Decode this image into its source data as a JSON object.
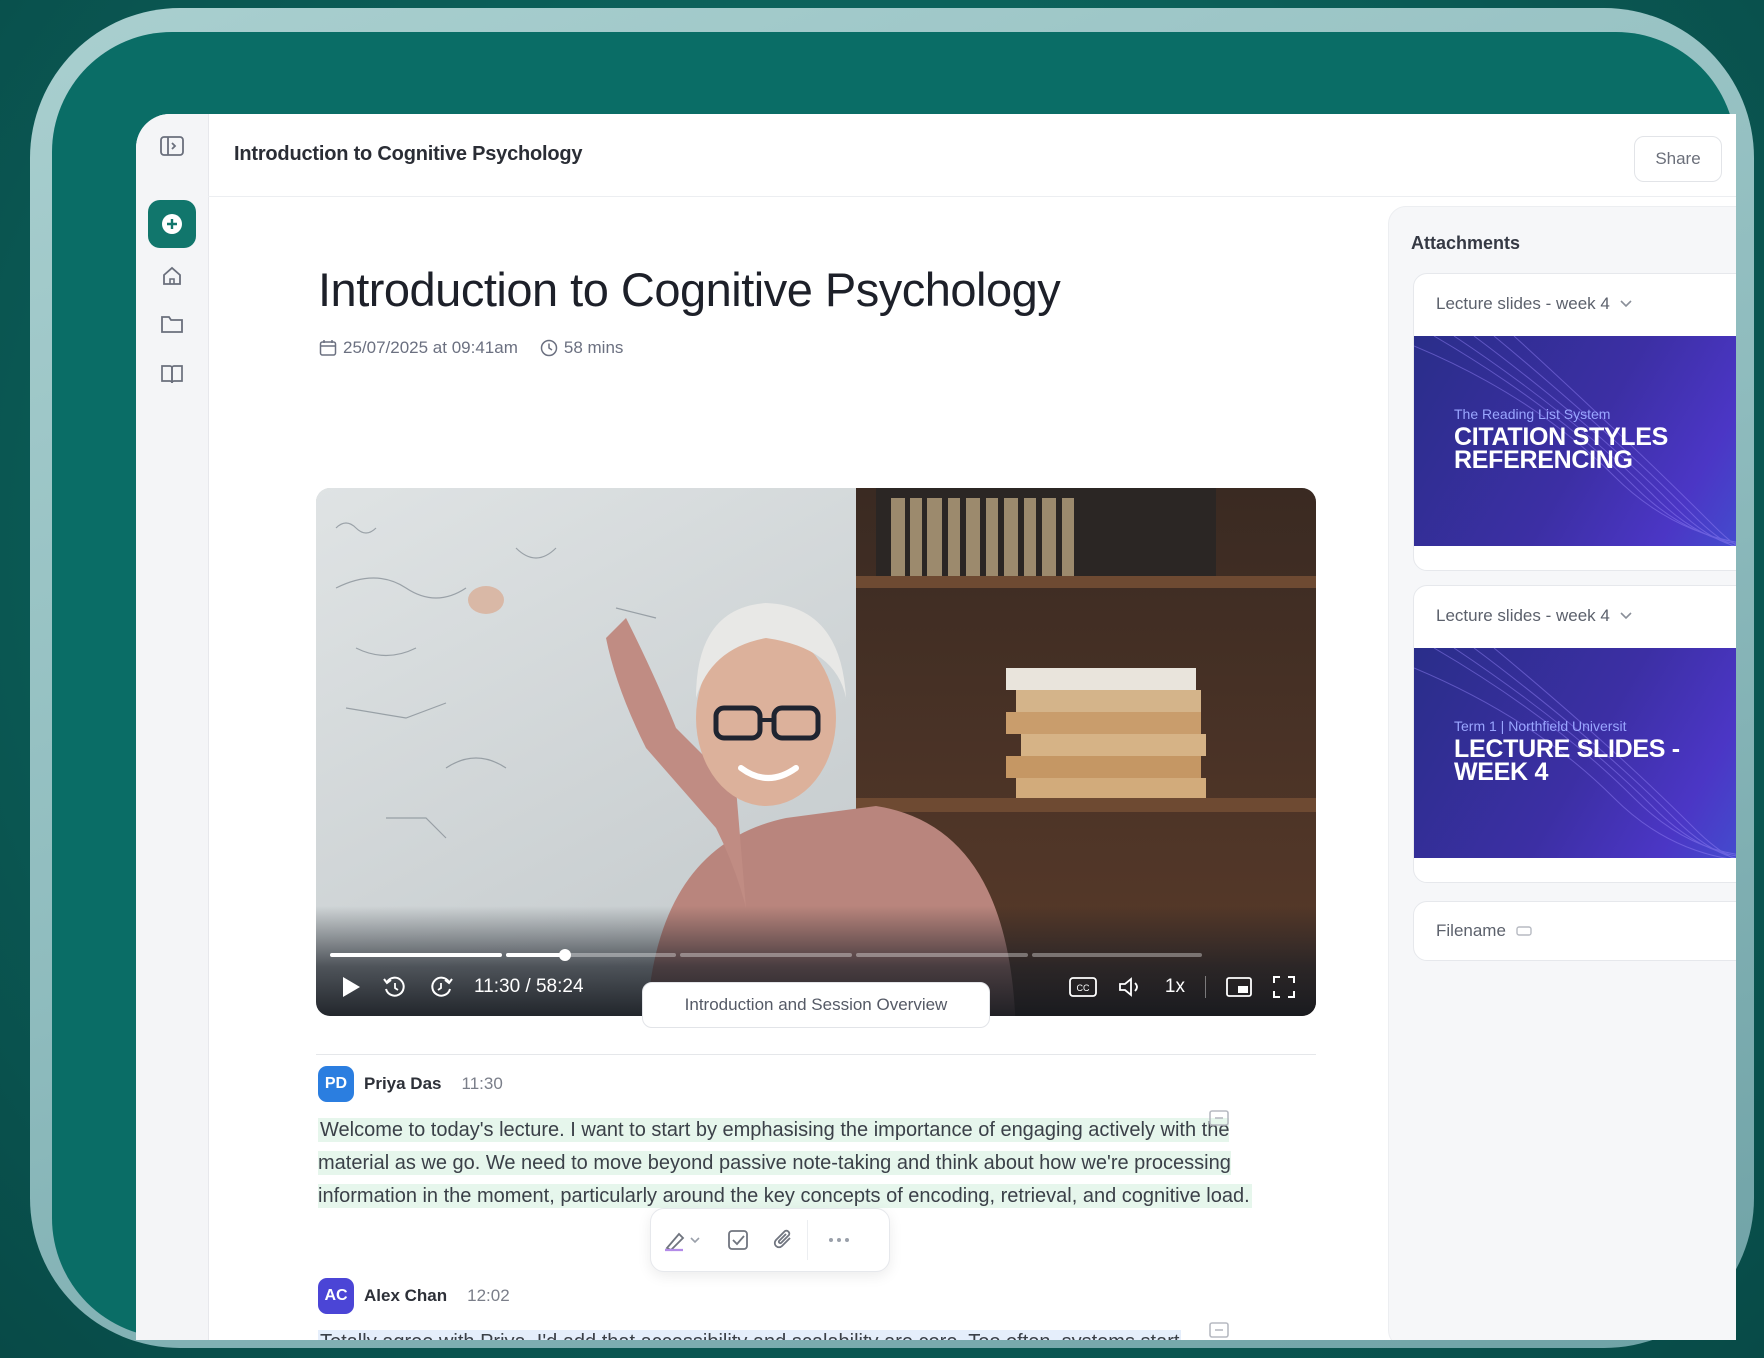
{
  "app": {
    "title": "Introduction to Cognitive Psychology",
    "share_label": "Share"
  },
  "rail": {
    "icons": [
      "sidebar-toggle-icon",
      "plus-icon",
      "home-icon",
      "folder-icon",
      "book-icon"
    ]
  },
  "lecture": {
    "heading": "Introduction to Cognitive Psychology",
    "date": "25/07/2025 at 09:41am",
    "duration": "58 mins"
  },
  "video": {
    "time": "11:30 / 58:24",
    "speed": "1x",
    "progress_fraction": 0.27
  },
  "chapter": {
    "label": "Introduction and Session Overview"
  },
  "transcript": [
    {
      "initials": "PD",
      "name": "Priya Das",
      "time": "11:30",
      "text": "Welcome to today's lecture. I want to start by emphasising the importance of engaging actively with the material as we go. We need to move beyond passive note-taking and think about how we're processing information in the moment, particularly around the key concepts of encoding, retrieval, and cognitive load."
    },
    {
      "initials": "AC",
      "name": "Alex Chan",
      "time": "12:02",
      "text": "Totally agree with Priya. I'd add that accessibility and scalability are core. Too often, systems start"
    }
  ],
  "attachments": {
    "heading": "Attachments",
    "items": [
      {
        "label": "Lecture slides - week 4",
        "thumb_sub": "The Reading List System",
        "thumb_title_1": "CITATION STYLES",
        "thumb_title_2": "REFERENCING"
      },
      {
        "label": "Lecture slides - week 4",
        "thumb_sub": "Term 1 | Northfield Universit",
        "thumb_title_1": "LECTURE SLIDES -",
        "thumb_title_2": "WEEK 4"
      }
    ],
    "filename_label": "Filename"
  },
  "colors": {
    "accent": "#11766c",
    "avatar_pd": "#2b7ee0",
    "avatar_ac": "#4b45d6",
    "highlight_green": "#e6f6ec",
    "highlight_blue": "#e5eefb"
  }
}
